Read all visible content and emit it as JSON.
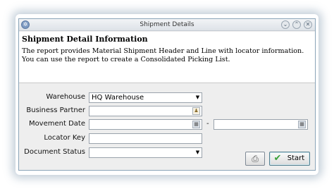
{
  "window": {
    "title": "Shipment Details",
    "controls": [
      "⌄",
      "⌃",
      "✕"
    ]
  },
  "header": {
    "title": "Shipment Detail Information",
    "description_line1": "The report provides Material Shipment Header and Line with locator information.",
    "description_line2": "You can use the report to create a Consolidated Picking List."
  },
  "form": {
    "warehouse_label": "Warehouse",
    "warehouse_value": "HQ Warehouse",
    "business_partner_label": "Business Partner",
    "business_partner_value": "",
    "movement_date_label": "Movement Date",
    "movement_date_from": "",
    "movement_date_separator": "-",
    "movement_date_to": "",
    "locator_key_label": "Locator Key",
    "locator_key_value": "",
    "document_status_label": "Document Status",
    "document_status_value": ""
  },
  "buttons": {
    "print_icon": "printer-icon",
    "start_label": "Start",
    "start_icon": "checkmark-icon"
  },
  "colors": {
    "window_border": "#8aa4b8",
    "panel_background": "#eeeeee",
    "check_green": "#3aa23a"
  }
}
